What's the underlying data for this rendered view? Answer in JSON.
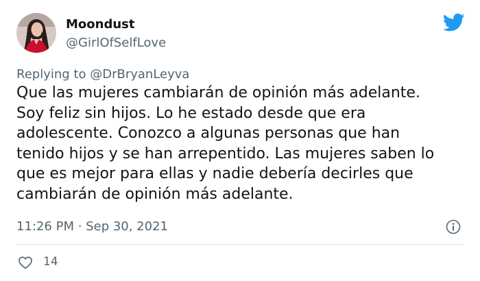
{
  "author": {
    "display_name": "Moondust",
    "handle": "@GirlOfSelfLove",
    "avatar_icon": "profile-photo-avatar"
  },
  "brand": {
    "icon": "twitter-bird-icon",
    "color": "#1d9bf0"
  },
  "reply": {
    "prefix": "Replying to",
    "mention": "@DrBryanLeyva"
  },
  "tweet": {
    "lines": [
      "Que las mujeres cambiarán de opinión más adelante.",
      "Soy feliz sin hijos. Lo he estado desde que era",
      "adolescente. Conozco a algunas personas que han",
      "tenido hijos y se han arrepentido. Las mujeres saben lo",
      "que es mejor para ellas y nadie debería decirles que",
      "cambiarán de opinión más adelante."
    ]
  },
  "meta": {
    "time": "11:26 PM",
    "separator": "·",
    "date": "Sep 30, 2021",
    "info_icon": "info-icon"
  },
  "engagement": {
    "like_icon": "heart-icon",
    "likes": "14"
  },
  "colors": {
    "text": "#0f1419",
    "secondary": "#536471",
    "divider": "#d8dee4"
  }
}
